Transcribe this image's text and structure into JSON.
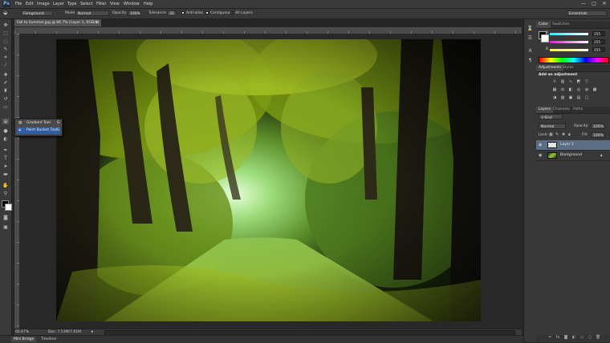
{
  "app": {
    "logo": "Ps"
  },
  "menubar": [
    "File",
    "Edit",
    "Image",
    "Layer",
    "Type",
    "Select",
    "Filter",
    "View",
    "Window",
    "Help"
  ],
  "window_controls": {
    "minimize": "—",
    "maximize": "□",
    "close": "✕"
  },
  "options": {
    "fill_source": "Foreground",
    "mode_label": "Mode:",
    "mode_value": "Normal",
    "opacity_label": "Opacity:",
    "opacity_value": "100%",
    "tolerance_label": "Tolerance:",
    "tolerance_value": "32",
    "antialias_label": "Anti-alias",
    "contiguous_label": "Contiguous",
    "alllayers_label": "All Layers",
    "workspace": "Essentials"
  },
  "document": {
    "tab_title": "Fall to Summer.jpg @ 66.7% (Layer 1, RGB/8) *",
    "zoom": "66.67%",
    "doc_info": "Doc: 7.53M/7.61M"
  },
  "flyout": {
    "items": [
      {
        "label": "Gradient Tool",
        "key": "G"
      },
      {
        "label": "Paint Bucket Tool",
        "key": "G"
      }
    ]
  },
  "bottom_tabs": [
    "Mini Bridge",
    "Timeline"
  ],
  "color_panel": {
    "tabs": [
      "Color",
      "Swatches"
    ],
    "channels": [
      {
        "label": "R",
        "value": "255",
        "color": "#e04848"
      },
      {
        "label": "G",
        "value": "255",
        "color": "#48c060"
      },
      {
        "label": "B",
        "value": "255",
        "color": "#4870e0"
      }
    ]
  },
  "adjustments_panel": {
    "tabs": [
      "Adjustments",
      "Styles"
    ],
    "heading": "Add an adjustment"
  },
  "layers_panel": {
    "tabs": [
      "Layers",
      "Channels",
      "Paths"
    ],
    "kind_filter": "Kind",
    "blend_mode": "Normal",
    "opacity_label": "Opacity:",
    "opacity_value": "100%",
    "lock_label": "Lock:",
    "fill_label": "Fill:",
    "fill_value": "100%",
    "layers": [
      {
        "name": "Layer 1",
        "selected": true
      },
      {
        "name": "Background",
        "selected": false,
        "locked": true
      }
    ]
  },
  "icons": {
    "toolbar": [
      "move-tool-icon",
      "marquee-tool-icon",
      "lasso-tool-icon",
      "quick-selection-tool-icon",
      "crop-tool-icon",
      "eyedropper-tool-icon",
      "spot-healing-tool-icon",
      "brush-tool-icon",
      "clone-stamp-tool-icon",
      "history-brush-tool-icon",
      "eraser-tool-icon",
      "paint-bucket-tool-icon",
      "blur-tool-icon",
      "dodge-tool-icon",
      "pen-tool-icon",
      "type-tool-icon",
      "path-selection-tool-icon",
      "rectangle-tool-icon",
      "hand-tool-icon",
      "zoom-tool-icon"
    ]
  }
}
